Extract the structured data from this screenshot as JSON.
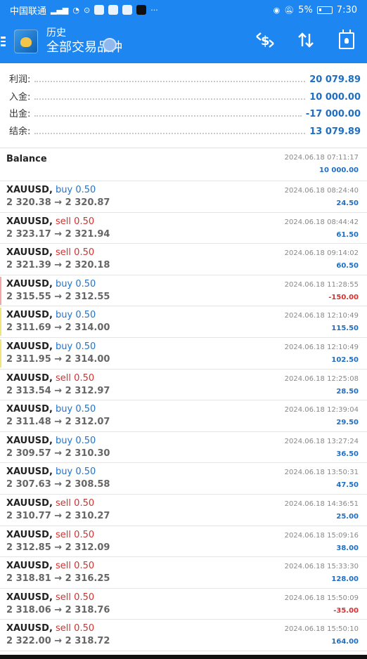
{
  "status_bar": {
    "carrier": "中国联通",
    "battery": "5%",
    "time": "7:30"
  },
  "app_bar": {
    "subtitle": "历史",
    "title": "全部交易品种",
    "actions": [
      "dollar-swap-icon",
      "sort-arrows-icon",
      "calendar-user-icon"
    ]
  },
  "summary": [
    {
      "label": "利润:",
      "value": "20 079.89"
    },
    {
      "label": "入金:",
      "value": "10 000.00"
    },
    {
      "label": "出金:",
      "value": "-17 000.00"
    },
    {
      "label": "结余:",
      "value": "13 079.89"
    }
  ],
  "balance_row": {
    "label": "Balance",
    "time": "2024.06.18 07:11:17",
    "amount": "10 000.00"
  },
  "deals": [
    {
      "symbol": "XAUUSD,",
      "type": "buy",
      "volume": "0.50",
      "prices": "2 320.38 → 2 320.87",
      "time": "2024.06.18 08:24:40",
      "profit": "24.50"
    },
    {
      "symbol": "XAUUSD,",
      "type": "sell",
      "volume": "0.50",
      "prices": "2 323.17 → 2 321.94",
      "time": "2024.06.18 08:44:42",
      "profit": "61.50"
    },
    {
      "symbol": "XAUUSD,",
      "type": "sell",
      "volume": "0.50",
      "prices": "2 321.39 → 2 320.18",
      "time": "2024.06.18 09:14:02",
      "profit": "60.50"
    },
    {
      "symbol": "XAUUSD,",
      "type": "buy",
      "volume": "0.50",
      "prices": "2 315.55 → 2 312.55",
      "time": "2024.06.18 11:28:55",
      "profit": "-150.00"
    },
    {
      "symbol": "XAUUSD,",
      "type": "buy",
      "volume": "0.50",
      "prices": "2 311.69 → 2 314.00",
      "time": "2024.06.18 12:10:49",
      "profit": "115.50"
    },
    {
      "symbol": "XAUUSD,",
      "type": "buy",
      "volume": "0.50",
      "prices": "2 311.95 → 2 314.00",
      "time": "2024.06.18 12:10:49",
      "profit": "102.50"
    },
    {
      "symbol": "XAUUSD,",
      "type": "sell",
      "volume": "0.50",
      "prices": "2 313.54 → 2 312.97",
      "time": "2024.06.18 12:25:08",
      "profit": "28.50"
    },
    {
      "symbol": "XAUUSD,",
      "type": "buy",
      "volume": "0.50",
      "prices": "2 311.48 → 2 312.07",
      "time": "2024.06.18 12:39:04",
      "profit": "29.50"
    },
    {
      "symbol": "XAUUSD,",
      "type": "buy",
      "volume": "0.50",
      "prices": "2 309.57 → 2 310.30",
      "time": "2024.06.18 13:27:24",
      "profit": "36.50"
    },
    {
      "symbol": "XAUUSD,",
      "type": "buy",
      "volume": "0.50",
      "prices": "2 307.63 → 2 308.58",
      "time": "2024.06.18 13:50:31",
      "profit": "47.50"
    },
    {
      "symbol": "XAUUSD,",
      "type": "sell",
      "volume": "0.50",
      "prices": "2 310.77 → 2 310.27",
      "time": "2024.06.18 14:36:51",
      "profit": "25.00"
    },
    {
      "symbol": "XAUUSD,",
      "type": "sell",
      "volume": "0.50",
      "prices": "2 312.85 → 2 312.09",
      "time": "2024.06.18 15:09:16",
      "profit": "38.00"
    },
    {
      "symbol": "XAUUSD,",
      "type": "sell",
      "volume": "0.50",
      "prices": "2 318.81 → 2 316.25",
      "time": "2024.06.18 15:33:30",
      "profit": "128.00"
    },
    {
      "symbol": "XAUUSD,",
      "type": "sell",
      "volume": "0.50",
      "prices": "2 318.06 → 2 318.76",
      "time": "2024.06.18 15:50:09",
      "profit": "-35.00"
    },
    {
      "symbol": "XAUUSD,",
      "type": "sell",
      "volume": "0.50",
      "prices": "2 322.00 → 2 318.72",
      "time": "2024.06.18 15:50:10",
      "profit": "164.00"
    }
  ],
  "colors": {
    "accent": "#1d86f1",
    "buy": "#1f73cf",
    "sell": "#d5312f",
    "loss_marker": "#f3a4a4",
    "profit_marker": "#f1e27a"
  }
}
